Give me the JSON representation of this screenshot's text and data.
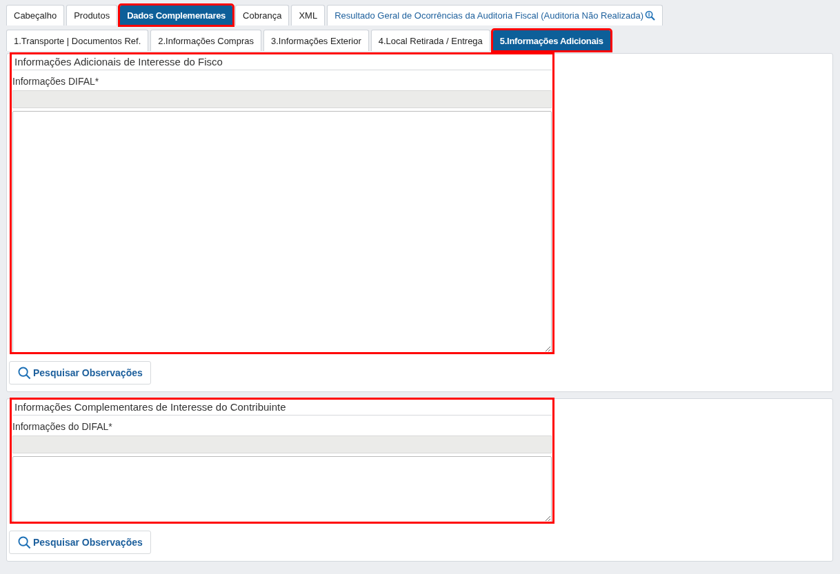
{
  "tabs": [
    {
      "label": "Cabeçalho",
      "selected": false,
      "highlighted": false,
      "kind": "plain"
    },
    {
      "label": "Produtos",
      "selected": false,
      "highlighted": false,
      "kind": "plain"
    },
    {
      "label": "Dados Complementares",
      "selected": true,
      "highlighted": true,
      "kind": "plain"
    },
    {
      "label": "Cobrança",
      "selected": false,
      "highlighted": false,
      "kind": "plain"
    },
    {
      "label": "XML",
      "selected": false,
      "highlighted": false,
      "kind": "plain"
    },
    {
      "label": "Resultado Geral de Ocorrências da Auditoria Fiscal (Auditoria Não Realizada)",
      "selected": false,
      "highlighted": false,
      "kind": "audit"
    }
  ],
  "subtabs": [
    {
      "label": "1.Transporte | Documentos Ref.",
      "selected": false,
      "highlighted": false
    },
    {
      "label": "2.Informações Compras",
      "selected": false,
      "highlighted": false
    },
    {
      "label": "3.Informações Exterior",
      "selected": false,
      "highlighted": false
    },
    {
      "label": "4.Local Retirada / Entrega",
      "selected": false,
      "highlighted": false
    },
    {
      "label": "5.Informações Adicionais",
      "selected": true,
      "highlighted": true
    }
  ],
  "sections": [
    {
      "title": "Informações Adicionais de Interesse do Fisco",
      "highlighted": true,
      "field_label": "Informações DIFAL*",
      "button": "Pesquisar Observações"
    },
    {
      "title": "Informações Complementares de Interesse do Contribuinte",
      "highlighted": true,
      "field_label": "Informações do DIFAL*",
      "button": "Pesquisar Observações"
    }
  ]
}
